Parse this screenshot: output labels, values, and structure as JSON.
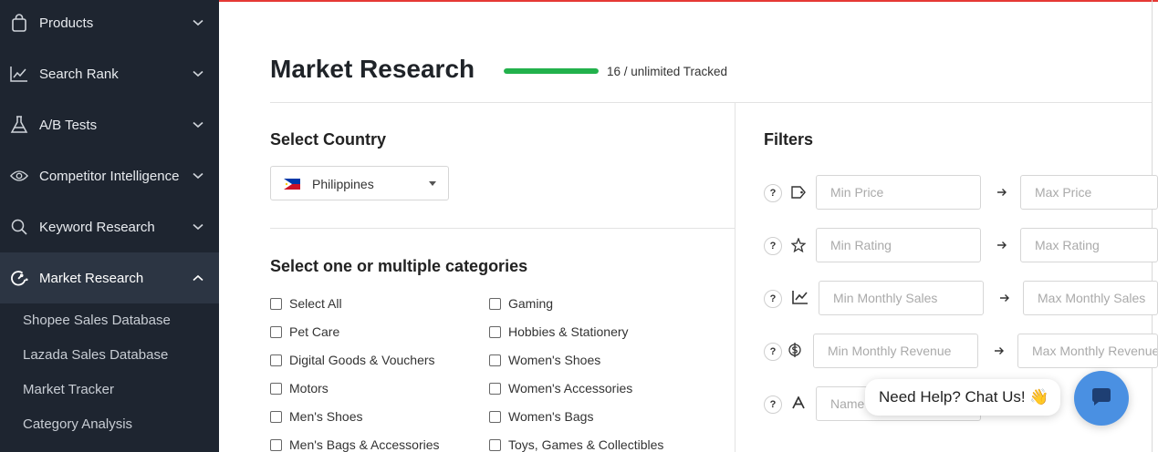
{
  "sidebar": {
    "items": [
      {
        "label": "Products",
        "icon": "shopping-bag-icon"
      },
      {
        "label": "Search Rank",
        "icon": "trend-line-icon"
      },
      {
        "label": "A/B Tests",
        "icon": "flask-icon"
      },
      {
        "label": "Competitor Intelligence",
        "icon": "eye-icon"
      },
      {
        "label": "Keyword Research",
        "icon": "search-icon"
      },
      {
        "label": "Market Research",
        "icon": "market-research-icon",
        "active": true
      }
    ],
    "subitems": [
      "Shopee Sales Database",
      "Lazada Sales Database",
      "Market Tracker",
      "Category Analysis"
    ]
  },
  "header": {
    "title": "Market Research",
    "tracked_text": "16 / unlimited Tracked",
    "progress_fraction": 1.0,
    "progress_color": "#22b14c"
  },
  "country": {
    "section_title": "Select Country",
    "selected": "Philippines",
    "flag": "philippines-flag-icon"
  },
  "categories": {
    "section_title": "Select one or multiple categories",
    "left": [
      "Select All",
      "Pet Care",
      "Digital Goods & Vouchers",
      "Motors",
      "Men's Shoes",
      "Men's Bags & Accessories"
    ],
    "right": [
      "Gaming",
      "Hobbies & Stationery",
      "Women's Shoes",
      "Women's Accessories",
      "Women's Bags",
      "Toys, Games & Collectibles"
    ]
  },
  "filters": {
    "section_title": "Filters",
    "help_label": "?",
    "rows": [
      {
        "icon": "tag-icon",
        "min_placeholder": "Min Price",
        "max_placeholder": "Max Price"
      },
      {
        "icon": "star-icon",
        "min_placeholder": "Min Rating",
        "max_placeholder": "Max Rating"
      },
      {
        "icon": "chart-line-icon",
        "min_placeholder": "Min Monthly Sales",
        "max_placeholder": "Max Monthly Sales"
      },
      {
        "icon": "dollar-icon",
        "min_placeholder": "Min Monthly Revenue",
        "max_placeholder": "Max Monthly Revenue"
      },
      {
        "icon": "font-icon",
        "min_placeholder": "Name",
        "max_placeholder": ""
      }
    ]
  },
  "chat": {
    "text": "Need Help? Chat Us! 👋",
    "button_icon": "chat-bubble-icon",
    "button_color": "#4a90e2"
  },
  "colors": {
    "sidebar_bg": "#1e2530",
    "sidebar_active_bg": "#2c3543",
    "top_accent": "#e53935"
  }
}
